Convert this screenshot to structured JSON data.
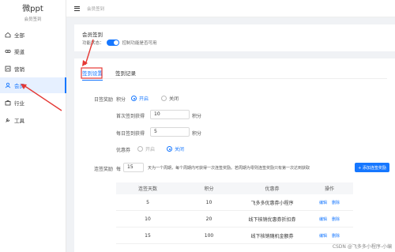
{
  "brand": {
    "title": "微ppt",
    "subtitle": "会员签到"
  },
  "sidebar": {
    "items": [
      {
        "label": "全部",
        "icon": "home-icon"
      },
      {
        "label": "渠道",
        "icon": "link-icon"
      },
      {
        "label": "营销",
        "icon": "chart-icon"
      },
      {
        "label": "会员",
        "icon": "user-icon",
        "active": true
      },
      {
        "label": "行业",
        "icon": "briefcase-icon"
      },
      {
        "label": "工具",
        "icon": "wrench-icon"
      }
    ]
  },
  "topbar": {
    "breadcrumb": "会员签到"
  },
  "panel1": {
    "title": "会员签到",
    "status_label": "功能状态：",
    "status_hint": "控制功能是否可用"
  },
  "tabs": [
    {
      "label": "签到设置",
      "active": true
    },
    {
      "label": "签到记录"
    }
  ],
  "form": {
    "daily_reward_label": "日签奖励",
    "points_label": "积分",
    "points_on": "开启",
    "points_off": "关闭",
    "first_sign_label": "首次签到获得",
    "first_sign_value": "10",
    "first_sign_unit": "积分",
    "daily_sign_label": "每日签到获得",
    "daily_sign_value": "5",
    "daily_sign_unit": "积分",
    "coupon_label": "优惠券",
    "coupon_on": "开启",
    "coupon_off": "关闭",
    "streak_label": "连签奖励",
    "streak_prefix": "每",
    "streak_value": "15",
    "streak_desc": "天为一个周期，每个周期内可获得一次连签奖励。若周期为零则连签奖励只有第一次达到获取",
    "add_button": "+ 添加连签奖励"
  },
  "table": {
    "headers": [
      "连签天数",
      "积分",
      "优惠券",
      "操作"
    ],
    "rows": [
      {
        "days": "5",
        "points": "10",
        "coupon": "飞多多优惠券小程序"
      },
      {
        "days": "10",
        "points": "20",
        "coupon": "线下核销优惠券折扣券"
      },
      {
        "days": "15",
        "points": "100",
        "coupon": "线下核销随机金额券"
      }
    ],
    "edit_label": "编辑",
    "delete_label": "删除"
  },
  "watermark": "CSDN @飞多多小程序-小编",
  "colors": {
    "accent": "#1677ff",
    "annotation": "#e53935"
  }
}
